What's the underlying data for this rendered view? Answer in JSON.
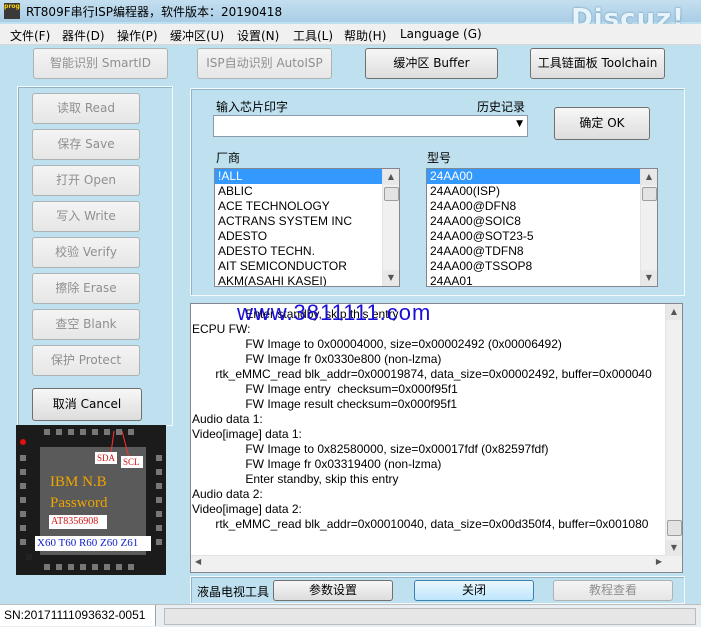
{
  "window": {
    "title": "RT809F串行ISP编程器，软件版本：20190418",
    "icon_label": "prog",
    "watermark": "Discuz!"
  },
  "menu": [
    "文件(F)",
    "器件(D)",
    "操作(P)",
    "缓冲区(U)",
    "设置(N)",
    "工具(L)",
    "帮助(H)",
    "Language (G)"
  ],
  "toolbar": {
    "smartid": "智能识别 SmartID",
    "autoisp": "ISP自动识别 AutoISP",
    "buffer": "缓冲区 Buffer",
    "toolchain": "工具链面板 Toolchain"
  },
  "ops": {
    "read": "读取 Read",
    "save": "保存 Save",
    "open": "打开 Open",
    "write": "写入 Write",
    "verify": "校验 Verify",
    "erase": "擦除 Erase",
    "blank": "查空 Blank",
    "protect": "保护 Protect",
    "cancel": "取消 Cancel"
  },
  "chip_panel": {
    "input_label": "输入芯片印字",
    "history_label": "历史记录",
    "ok_button": "确定 OK",
    "vendor_label": "厂商",
    "model_label": "型号",
    "vendors": [
      "!ALL",
      "ABLIC",
      "ACE TECHNOLOGY",
      "ACTRANS SYSTEM INC",
      "ADESTO",
      "ADESTO TECHN.",
      "AIT SEMICONDUCTOR",
      "AKM(ASAHI KASEI)"
    ],
    "models": [
      "24AA00",
      "24AA00(ISP)",
      "24AA00@DFN8",
      "24AA00@SOIC8",
      "24AA00@SOT23-5",
      "24AA00@TDFN8",
      "24AA00@TSSOP8",
      "24AA01"
    ]
  },
  "log": {
    "overlay_text": "www.3811111.com",
    "lines": [
      "                Enter standby, skip this entry",
      "ECPU FW:",
      "                FW Image to 0x00004000, size=0x00002492 (0x00006492)",
      "                FW Image fr 0x0330e800 (non-lzma)",
      "       rtk_eMMC_read blk_addr=0x00019874, data_size=0x00002492, buffer=0x000040",
      "                FW Image entry  checksum=0x000f95f1",
      "                FW Image result checksum=0x000f95f1",
      "Audio data 1:",
      "Video[image] data 1:",
      "                FW Image to 0x82580000, size=0x00017fdf (0x82597fdf)",
      "                FW Image fr 0x03319400 (non-lzma)",
      "                Enter standby, skip this entry",
      "Audio data 2:",
      "Video[image] data 2:",
      "       rtk_eMMC_read blk_addr=0x00010040, data_size=0x00d350f4, buffer=0x001080"
    ]
  },
  "chip_image": {
    "pin_sda": "SDA",
    "pin_scl": "SCL",
    "brand": "IBM  N.B",
    "password": "Password",
    "code": "AT8356908",
    "pins": "X60 T60 R60 Z60 Z61"
  },
  "bottom": {
    "lcd_tools": "液晶电视工具",
    "params": "参数设置",
    "close": "关闭",
    "tutorial": "教程查看"
  },
  "status": {
    "serial": "SN:20171111093632-0051"
  }
}
